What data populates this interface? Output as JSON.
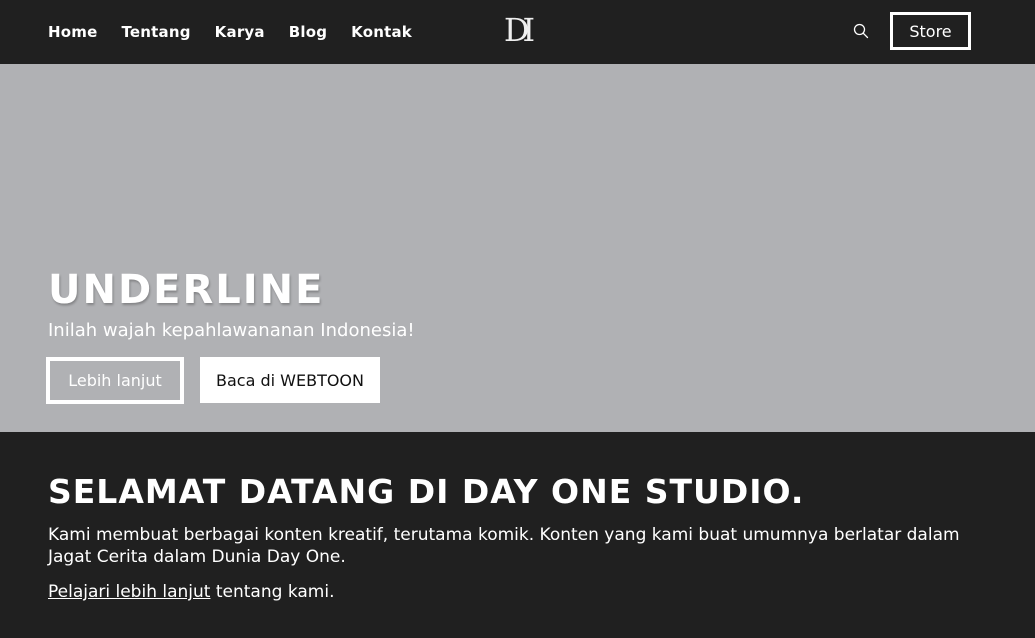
{
  "nav": {
    "links": [
      "Home",
      "Tentang",
      "Karya",
      "Blog",
      "Kontak"
    ],
    "logo_text": "DI",
    "search_icon": "search-icon",
    "store_label": "Store"
  },
  "hero": {
    "title": "UNDERLINE",
    "subtitle": "Inilah wajah kepahlawananan Indonesia!",
    "more_label": "Lebih lanjut",
    "webtoon_label": "Baca di WEBTOON",
    "background_color": "#b0b1b4"
  },
  "welcome": {
    "title": "SELAMAT DATANG DI DAY ONE STUDIO.",
    "body": "Kami membuat berbagai konten kreatif, terutama komik. Konten yang kami buat umumnya berlatar dalam Jagat Cerita dalam Dunia Day One.",
    "link_text": "Pelajari lebih lanjut",
    "link_suffix": " tentang kami."
  },
  "colors": {
    "dark": "#202020",
    "white": "#ffffff"
  }
}
